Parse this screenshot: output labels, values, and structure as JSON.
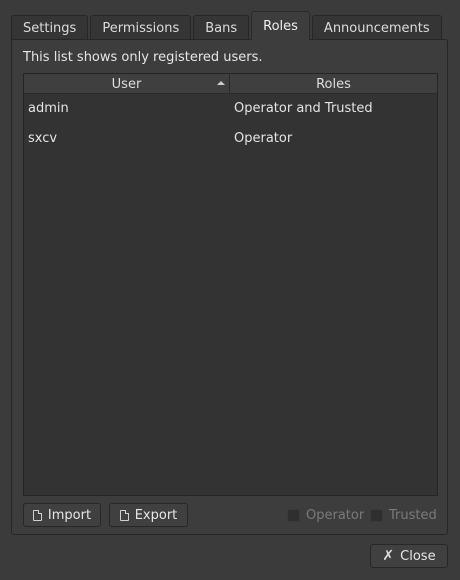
{
  "tabs": [
    {
      "label": "Settings",
      "active": false
    },
    {
      "label": "Permissions",
      "active": false
    },
    {
      "label": "Bans",
      "active": false
    },
    {
      "label": "Roles",
      "active": true
    },
    {
      "label": "Announcements",
      "active": false
    }
  ],
  "info_text": "This list shows only registered users.",
  "table": {
    "headers": {
      "user": "User",
      "roles": "Roles"
    },
    "sort_column": "User",
    "sort_order": "ascending",
    "rows": [
      {
        "user": "admin",
        "roles": "Operator and Trusted"
      },
      {
        "user": "sxcv",
        "roles": "Operator"
      }
    ]
  },
  "buttons": {
    "import_label": "Import",
    "export_label": "Export",
    "close_label": "Close"
  },
  "checkboxes": {
    "operator": {
      "label": "Operator",
      "checked": false,
      "enabled": false
    },
    "trusted": {
      "label": "Trusted",
      "checked": false,
      "enabled": false
    }
  },
  "icons": {
    "import": "document-import-icon",
    "export": "document-export-icon",
    "close": "close-x-icon",
    "sort": "sort-ascending-icon"
  }
}
